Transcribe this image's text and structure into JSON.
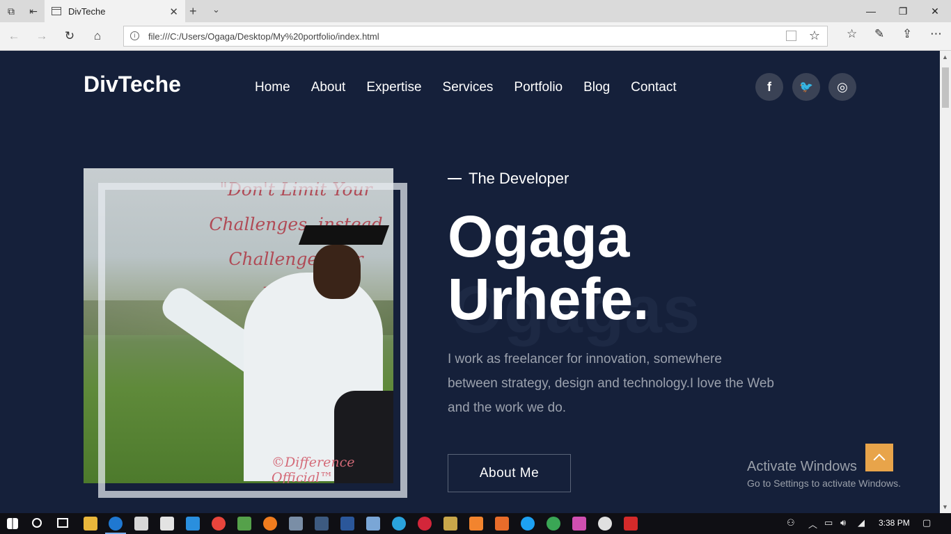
{
  "browser": {
    "tab_title": "DivTeche",
    "url": "file:///C:/Users/Ogaga/Desktop/My%20portfolio/index.html"
  },
  "site": {
    "logo": "DivTeche",
    "menu": [
      "Home",
      "About",
      "Expertise",
      "Services",
      "Portfolio",
      "Blog",
      "Contact"
    ],
    "social_icons": [
      "facebook-icon",
      "twitter-icon",
      "instagram-icon"
    ],
    "social_glyphs": [
      "f",
      "🐦",
      "◎"
    ]
  },
  "hero": {
    "kicker": "The Developer",
    "name_line1": "Ogaga",
    "name_line2": "Urhefe.",
    "background_word": "Ogagas",
    "bio": "I work as freelancer for innovation, somewhere between strategy, design and technology.I love the Web and the work we do.",
    "cta": "About Me",
    "photo_quote": "\"Don't Limit Your Challenges, instead Challenge Your Limits.\"",
    "photo_watermark": "©Difference Official™"
  },
  "os": {
    "activate_title": "Activate Windows",
    "activate_sub": "Go to Settings to activate Windows.",
    "clock": "3:38 PM"
  },
  "colors": {
    "page_bg": "#15203a",
    "accent": "#e8a44a"
  }
}
